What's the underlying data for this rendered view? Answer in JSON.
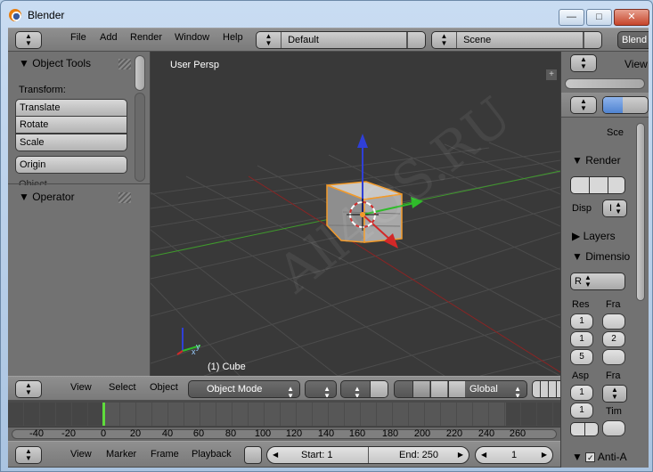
{
  "window": {
    "title": "Blender"
  },
  "info_header": {
    "menus": [
      "File",
      "Add",
      "Render",
      "Window",
      "Help"
    ],
    "screen_layout": "Default",
    "scene": "Scene",
    "engine": "Blend"
  },
  "tools_panel": {
    "title": "Object Tools",
    "transform_label": "Transform:",
    "buttons": [
      "Translate",
      "Rotate",
      "Scale"
    ],
    "origin_button": "Origin",
    "cut_label": "Object",
    "operator_title": "Operator"
  },
  "viewport": {
    "view_name": "User Persp",
    "object_label": "(1) Cube",
    "watermark": "All4OS.RU",
    "axis_y": "y",
    "axis_x": "x"
  },
  "view3d_header": {
    "menus": [
      "View",
      "Select",
      "Object"
    ],
    "mode": "Object Mode",
    "orientation": "Global"
  },
  "timeline": {
    "ruler": [
      "-40",
      "-20",
      "0",
      "20",
      "40",
      "60",
      "80",
      "100",
      "120",
      "140",
      "160",
      "180",
      "200",
      "220",
      "240",
      "260"
    ],
    "menus": [
      "View",
      "Marker",
      "Frame",
      "Playback"
    ],
    "start": "Start: 1",
    "end": "End: 250",
    "current": "1"
  },
  "properties": {
    "view_label": "View",
    "scene_label": "Sce",
    "render_title": "Render",
    "display_label": "Disp",
    "layers_title": "Layers",
    "dimensions_title": "Dimensio",
    "render_presets": "R",
    "res_label": "Res",
    "frame_label": "Fra",
    "res_values": [
      "1",
      "1",
      "5"
    ],
    "frame_values": [
      "",
      "2",
      ""
    ],
    "aspect_label": "Asp",
    "frame_rate_label": "Fra",
    "aspect_values": [
      "1",
      "1"
    ],
    "time_label": "Tim",
    "antialias_label": "Anti-A"
  }
}
